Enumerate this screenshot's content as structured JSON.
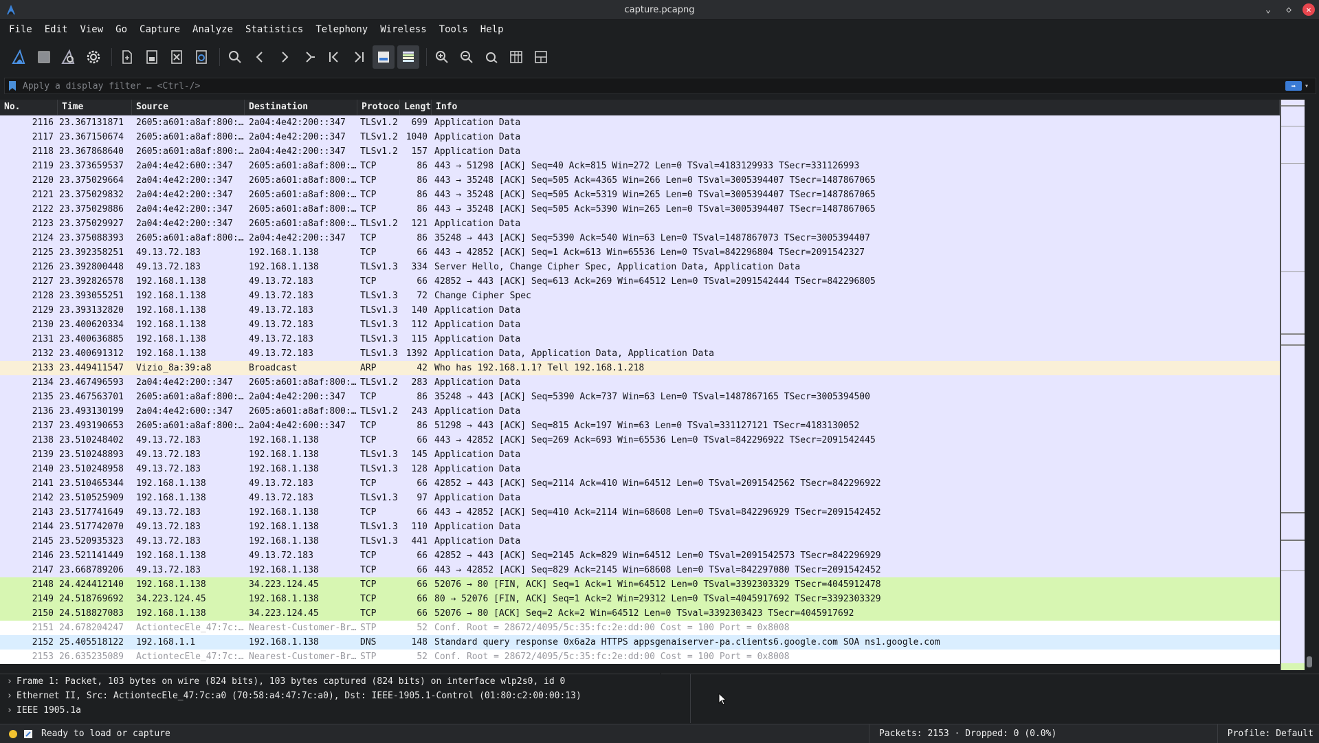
{
  "window": {
    "title": "capture.pcapng"
  },
  "menu": [
    "File",
    "Edit",
    "View",
    "Go",
    "Capture",
    "Analyze",
    "Statistics",
    "Telephony",
    "Wireless",
    "Tools",
    "Help"
  ],
  "filter": {
    "placeholder": "Apply a display filter … <Ctrl-/>"
  },
  "columns": {
    "no": "No.",
    "time": "Time",
    "source": "Source",
    "destination": "Destination",
    "protocol": "Protoco",
    "length": "Lengt",
    "info": "Info"
  },
  "packets": [
    {
      "no": "2116",
      "time": "23.367131871",
      "src": "2605:a601:a8af:800:…",
      "dst": "2a04:4e42:200::347",
      "proto": "TLSv1.2",
      "len": "699",
      "info": "Application Data",
      "type": "normal"
    },
    {
      "no": "2117",
      "time": "23.367150674",
      "src": "2605:a601:a8af:800:…",
      "dst": "2a04:4e42:200::347",
      "proto": "TLSv1.2",
      "len": "1040",
      "info": "Application Data",
      "type": "normal"
    },
    {
      "no": "2118",
      "time": "23.367868640",
      "src": "2605:a601:a8af:800:…",
      "dst": "2a04:4e42:200::347",
      "proto": "TLSv1.2",
      "len": "157",
      "info": "Application Data",
      "type": "normal"
    },
    {
      "no": "2119",
      "time": "23.373659537",
      "src": "2a04:4e42:600::347",
      "dst": "2605:a601:a8af:800:…",
      "proto": "TCP",
      "len": "86",
      "info": "443 → 51298 [ACK] Seq=40 Ack=815 Win=272 Len=0 TSval=4183129933 TSecr=331126993",
      "type": "normal"
    },
    {
      "no": "2120",
      "time": "23.375029664",
      "src": "2a04:4e42:200::347",
      "dst": "2605:a601:a8af:800:…",
      "proto": "TCP",
      "len": "86",
      "info": "443 → 35248 [ACK] Seq=505 Ack=4365 Win=266 Len=0 TSval=3005394407 TSecr=1487867065",
      "type": "normal"
    },
    {
      "no": "2121",
      "time": "23.375029832",
      "src": "2a04:4e42:200::347",
      "dst": "2605:a601:a8af:800:…",
      "proto": "TCP",
      "len": "86",
      "info": "443 → 35248 [ACK] Seq=505 Ack=5319 Win=265 Len=0 TSval=3005394407 TSecr=1487867065",
      "type": "normal"
    },
    {
      "no": "2122",
      "time": "23.375029886",
      "src": "2a04:4e42:200::347",
      "dst": "2605:a601:a8af:800:…",
      "proto": "TCP",
      "len": "86",
      "info": "443 → 35248 [ACK] Seq=505 Ack=5390 Win=265 Len=0 TSval=3005394407 TSecr=1487867065",
      "type": "normal"
    },
    {
      "no": "2123",
      "time": "23.375029927",
      "src": "2a04:4e42:200::347",
      "dst": "2605:a601:a8af:800:…",
      "proto": "TLSv1.2",
      "len": "121",
      "info": "Application Data",
      "type": "normal"
    },
    {
      "no": "2124",
      "time": "23.375088393",
      "src": "2605:a601:a8af:800:…",
      "dst": "2a04:4e42:200::347",
      "proto": "TCP",
      "len": "86",
      "info": "35248 → 443 [ACK] Seq=5390 Ack=540 Win=63 Len=0 TSval=1487867073 TSecr=3005394407",
      "type": "normal"
    },
    {
      "no": "2125",
      "time": "23.392358251",
      "src": "49.13.72.183",
      "dst": "192.168.1.138",
      "proto": "TCP",
      "len": "66",
      "info": "443 → 42852 [ACK] Seq=1 Ack=613 Win=65536 Len=0 TSval=842296804 TSecr=2091542327",
      "type": "normal"
    },
    {
      "no": "2126",
      "time": "23.392800448",
      "src": "49.13.72.183",
      "dst": "192.168.1.138",
      "proto": "TLSv1.3",
      "len": "334",
      "info": "Server Hello, Change Cipher Spec, Application Data, Application Data",
      "type": "normal"
    },
    {
      "no": "2127",
      "time": "23.392826578",
      "src": "192.168.1.138",
      "dst": "49.13.72.183",
      "proto": "TCP",
      "len": "66",
      "info": "42852 → 443 [ACK] Seq=613 Ack=269 Win=64512 Len=0 TSval=2091542444 TSecr=842296805",
      "type": "normal"
    },
    {
      "no": "2128",
      "time": "23.393055251",
      "src": "192.168.1.138",
      "dst": "49.13.72.183",
      "proto": "TLSv1.3",
      "len": "72",
      "info": "Change Cipher Spec",
      "type": "normal"
    },
    {
      "no": "2129",
      "time": "23.393132820",
      "src": "192.168.1.138",
      "dst": "49.13.72.183",
      "proto": "TLSv1.3",
      "len": "140",
      "info": "Application Data",
      "type": "normal"
    },
    {
      "no": "2130",
      "time": "23.400620334",
      "src": "192.168.1.138",
      "dst": "49.13.72.183",
      "proto": "TLSv1.3",
      "len": "112",
      "info": "Application Data",
      "type": "normal"
    },
    {
      "no": "2131",
      "time": "23.400636885",
      "src": "192.168.1.138",
      "dst": "49.13.72.183",
      "proto": "TLSv1.3",
      "len": "115",
      "info": "Application Data",
      "type": "normal"
    },
    {
      "no": "2132",
      "time": "23.400691312",
      "src": "192.168.1.138",
      "dst": "49.13.72.183",
      "proto": "TLSv1.3",
      "len": "1392",
      "info": "Application Data, Application Data, Application Data",
      "type": "normal"
    },
    {
      "no": "2133",
      "time": "23.449411547",
      "src": "Vizio_8a:39:a8",
      "dst": "Broadcast",
      "proto": "ARP",
      "len": "42",
      "info": "Who has 192.168.1.1? Tell 192.168.1.218",
      "type": "arp"
    },
    {
      "no": "2134",
      "time": "23.467496593",
      "src": "2a04:4e42:200::347",
      "dst": "2605:a601:a8af:800:…",
      "proto": "TLSv1.2",
      "len": "283",
      "info": "Application Data",
      "type": "normal"
    },
    {
      "no": "2135",
      "time": "23.467563701",
      "src": "2605:a601:a8af:800:…",
      "dst": "2a04:4e42:200::347",
      "proto": "TCP",
      "len": "86",
      "info": "35248 → 443 [ACK] Seq=5390 Ack=737 Win=63 Len=0 TSval=1487867165 TSecr=3005394500",
      "type": "normal"
    },
    {
      "no": "2136",
      "time": "23.493130199",
      "src": "2a04:4e42:600::347",
      "dst": "2605:a601:a8af:800:…",
      "proto": "TLSv1.2",
      "len": "243",
      "info": "Application Data",
      "type": "normal"
    },
    {
      "no": "2137",
      "time": "23.493190653",
      "src": "2605:a601:a8af:800:…",
      "dst": "2a04:4e42:600::347",
      "proto": "TCP",
      "len": "86",
      "info": "51298 → 443 [ACK] Seq=815 Ack=197 Win=63 Len=0 TSval=331127121 TSecr=4183130052",
      "type": "normal"
    },
    {
      "no": "2138",
      "time": "23.510248402",
      "src": "49.13.72.183",
      "dst": "192.168.1.138",
      "proto": "TCP",
      "len": "66",
      "info": "443 → 42852 [ACK] Seq=269 Ack=693 Win=65536 Len=0 TSval=842296922 TSecr=2091542445",
      "type": "normal"
    },
    {
      "no": "2139",
      "time": "23.510248893",
      "src": "49.13.72.183",
      "dst": "192.168.1.138",
      "proto": "TLSv1.3",
      "len": "145",
      "info": "Application Data",
      "type": "normal"
    },
    {
      "no": "2140",
      "time": "23.510248958",
      "src": "49.13.72.183",
      "dst": "192.168.1.138",
      "proto": "TLSv1.3",
      "len": "128",
      "info": "Application Data",
      "type": "normal"
    },
    {
      "no": "2141",
      "time": "23.510465344",
      "src": "192.168.1.138",
      "dst": "49.13.72.183",
      "proto": "TCP",
      "len": "66",
      "info": "42852 → 443 [ACK] Seq=2114 Ack=410 Win=64512 Len=0 TSval=2091542562 TSecr=842296922",
      "type": "normal"
    },
    {
      "no": "2142",
      "time": "23.510525909",
      "src": "192.168.1.138",
      "dst": "49.13.72.183",
      "proto": "TLSv1.3",
      "len": "97",
      "info": "Application Data",
      "type": "normal"
    },
    {
      "no": "2143",
      "time": "23.517741649",
      "src": "49.13.72.183",
      "dst": "192.168.1.138",
      "proto": "TCP",
      "len": "66",
      "info": "443 → 42852 [ACK] Seq=410 Ack=2114 Win=68608 Len=0 TSval=842296929 TSecr=2091542452",
      "type": "normal"
    },
    {
      "no": "2144",
      "time": "23.517742070",
      "src": "49.13.72.183",
      "dst": "192.168.1.138",
      "proto": "TLSv1.3",
      "len": "110",
      "info": "Application Data",
      "type": "normal"
    },
    {
      "no": "2145",
      "time": "23.520935323",
      "src": "49.13.72.183",
      "dst": "192.168.1.138",
      "proto": "TLSv1.3",
      "len": "441",
      "info": "Application Data",
      "type": "normal"
    },
    {
      "no": "2146",
      "time": "23.521141449",
      "src": "192.168.1.138",
      "dst": "49.13.72.183",
      "proto": "TCP",
      "len": "66",
      "info": "42852 → 443 [ACK] Seq=2145 Ack=829 Win=64512 Len=0 TSval=2091542573 TSecr=842296929",
      "type": "normal"
    },
    {
      "no": "2147",
      "time": "23.668789206",
      "src": "49.13.72.183",
      "dst": "192.168.1.138",
      "proto": "TCP",
      "len": "66",
      "info": "443 → 42852 [ACK] Seq=829 Ack=2145 Win=68608 Len=0 TSval=842297080 TSecr=2091542452",
      "type": "normal"
    },
    {
      "no": "2148",
      "time": "24.424412140",
      "src": "192.168.1.138",
      "dst": "34.223.124.45",
      "proto": "TCP",
      "len": "66",
      "info": "52076 → 80 [FIN, ACK] Seq=1 Ack=1 Win=64512 Len=0 TSval=3392303329 TSecr=4045912478",
      "type": "fin"
    },
    {
      "no": "2149",
      "time": "24.518769692",
      "src": "34.223.124.45",
      "dst": "192.168.1.138",
      "proto": "TCP",
      "len": "66",
      "info": "80 → 52076 [FIN, ACK] Seq=1 Ack=2 Win=29312 Len=0 TSval=4045917692 TSecr=3392303329",
      "type": "fin"
    },
    {
      "no": "2150",
      "time": "24.518827083",
      "src": "192.168.1.138",
      "dst": "34.223.124.45",
      "proto": "TCP",
      "len": "66",
      "info": "52076 → 80 [ACK] Seq=2 Ack=2 Win=64512 Len=0 TSval=3392303423 TSecr=4045917692",
      "type": "fin"
    },
    {
      "no": "2151",
      "time": "24.678204247",
      "src": "ActiontecEle_47:7c:…",
      "dst": "Nearest-Customer-Br…",
      "proto": "STP",
      "len": "52",
      "info": "Conf. Root = 28672/4095/5c:35:fc:2e:dd:00  Cost = 100  Port = 0x8008",
      "type": "stp"
    },
    {
      "no": "2152",
      "time": "25.405518122",
      "src": "192.168.1.1",
      "dst": "192.168.1.138",
      "proto": "DNS",
      "len": "148",
      "info": "Standard query response 0x6a2a HTTPS appsgenaiserver-pa.clients6.google.com SOA ns1.google.com",
      "type": "dns"
    },
    {
      "no": "2153",
      "time": "26.635235089",
      "src": "ActiontecEle_47:7c:…",
      "dst": "Nearest-Customer-Br…",
      "proto": "STP",
      "len": "52",
      "info": "Conf. Root = 28672/4095/5c:35:fc:2e:dd:00  Cost = 100  Port = 0x8008",
      "type": "stp"
    }
  ],
  "details": [
    "Frame 1: Packet, 103 bytes on wire (824 bits), 103 bytes captured (824 bits) on interface wlp2s0, id 0",
    "Ethernet II, Src: ActiontecEle_47:7c:a0 (70:58:a4:47:7c:a0), Dst: IEEE-1905.1-Control (01:80:c2:00:00:13)",
    "IEEE 1905.1a"
  ],
  "status": {
    "text": "Ready to load or capture",
    "packets": "Packets: 2153 · Dropped: 0 (0.0%)",
    "profile": "Profile: Default"
  },
  "colors": {
    "normal": "#e7e6ff",
    "arp": "#faf0d7",
    "fin": "#d7f6b2",
    "stp": "#ffffff",
    "dns": "#daeeff"
  }
}
